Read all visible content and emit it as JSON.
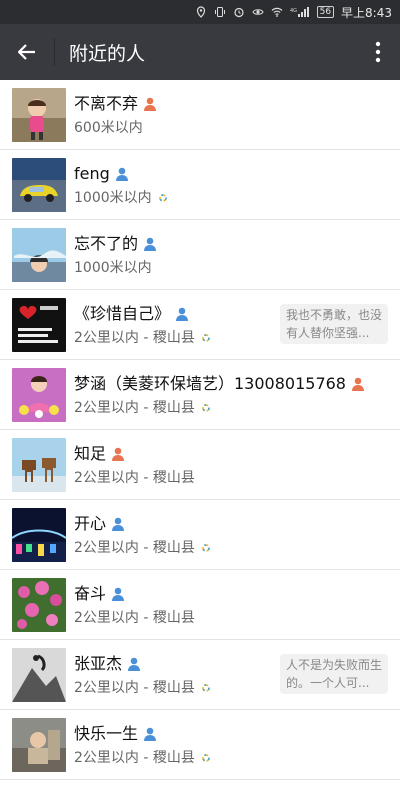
{
  "status_bar": {
    "time": "早上8:43",
    "battery": "56",
    "signal_label": "4G"
  },
  "header": {
    "title": "附近的人"
  },
  "people": [
    {
      "name": "不离不弃",
      "gender": "female",
      "distance": "600米以内",
      "ring": false,
      "signature": ""
    },
    {
      "name": "feng",
      "gender": "male",
      "distance": "1000米以内",
      "ring": true,
      "signature": ""
    },
    {
      "name": "忘不了的",
      "gender": "male",
      "distance": "1000米以内",
      "ring": false,
      "signature": ""
    },
    {
      "name": "《珍惜自己》",
      "gender": "male",
      "distance": "2公里以内 - 稷山县",
      "ring": true,
      "signature": "我也不勇敢，也没有人替你坚强..."
    },
    {
      "name": "梦涵（美菱环保墙艺）13008015768",
      "gender": "female",
      "distance": "2公里以内 - 稷山县",
      "ring": true,
      "signature": ""
    },
    {
      "name": "知足",
      "gender": "female",
      "distance": "2公里以内 - 稷山县",
      "ring": false,
      "signature": ""
    },
    {
      "name": "开心",
      "gender": "male",
      "distance": "2公里以内 - 稷山县",
      "ring": true,
      "signature": ""
    },
    {
      "name": "奋斗",
      "gender": "male",
      "distance": "2公里以内 - 稷山县",
      "ring": false,
      "signature": ""
    },
    {
      "name": "张亚杰",
      "gender": "male",
      "distance": "2公里以内 - 稷山县",
      "ring": true,
      "signature": "人不是为失败而生的。一个人可..."
    },
    {
      "name": "快乐一生",
      "gender": "male",
      "distance": "2公里以内 - 稷山县",
      "ring": true,
      "signature": ""
    }
  ],
  "colors": {
    "male": "#4a90d9",
    "female": "#e8744f",
    "titlebar": "#393a3f",
    "statusbar": "#2b2d30"
  }
}
